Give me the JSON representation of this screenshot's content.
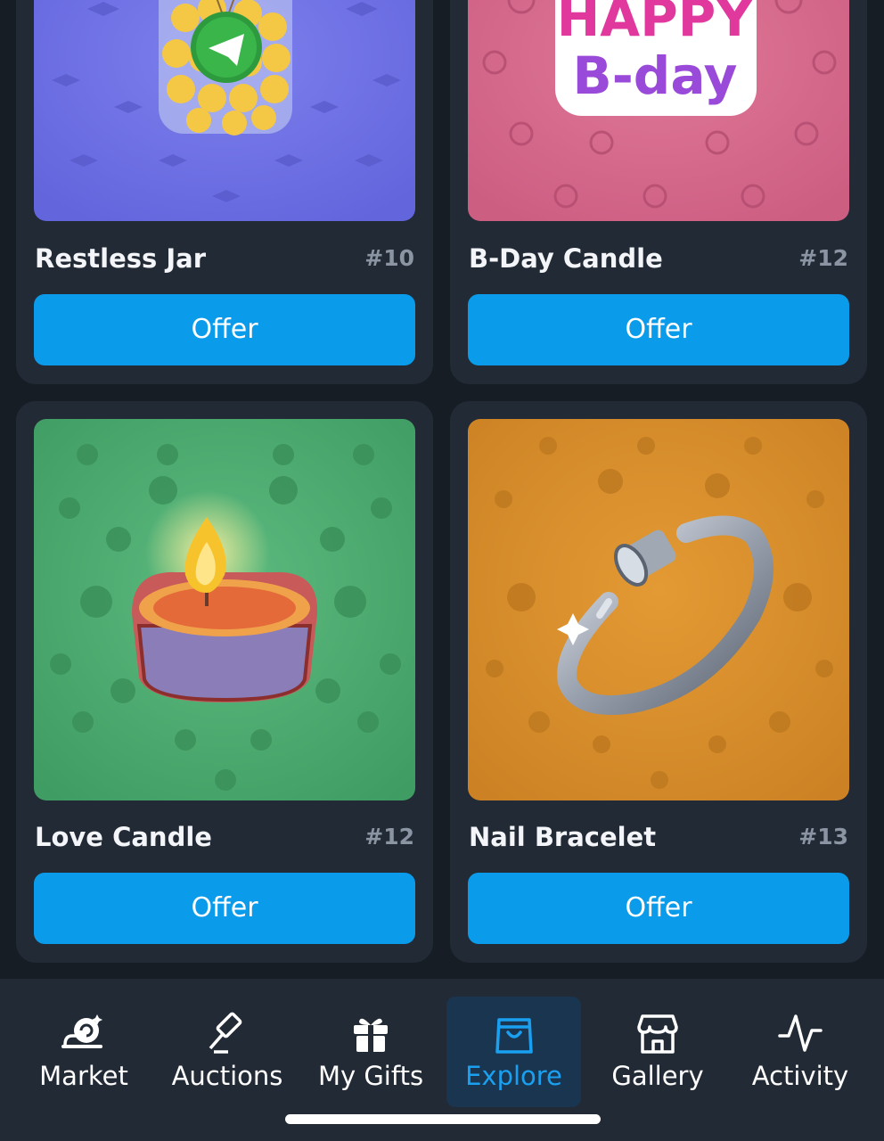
{
  "gifts": [
    {
      "name": "Restless Jar",
      "number": "#10",
      "action": "Offer"
    },
    {
      "name": "B-Day Candle",
      "number": "#12",
      "action": "Offer"
    },
    {
      "name": "Love Candle",
      "number": "#12",
      "action": "Offer"
    },
    {
      "name": "Nail Bracelet",
      "number": "#13",
      "action": "Offer"
    }
  ],
  "artwork_text": {
    "happy": "HAPPY",
    "bday": "B-day"
  },
  "nav": {
    "items": [
      {
        "label": "Market",
        "icon": "snail-icon"
      },
      {
        "label": "Auctions",
        "icon": "gavel-icon"
      },
      {
        "label": "My Gifts",
        "icon": "gift-icon"
      },
      {
        "label": "Explore",
        "icon": "shopping-bag-icon",
        "active": true
      },
      {
        "label": "Gallery",
        "icon": "storefront-icon"
      },
      {
        "label": "Activity",
        "icon": "pulse-icon"
      }
    ]
  },
  "colors": {
    "accent": "#0a9beb",
    "card_bg": "#222a35",
    "page_bg": "#171d25",
    "jar_bg": "#6f6ee6",
    "bday_bg": "#d86a8e",
    "love_bg": "#4aa86e",
    "nail_bg": "#d8902e"
  }
}
